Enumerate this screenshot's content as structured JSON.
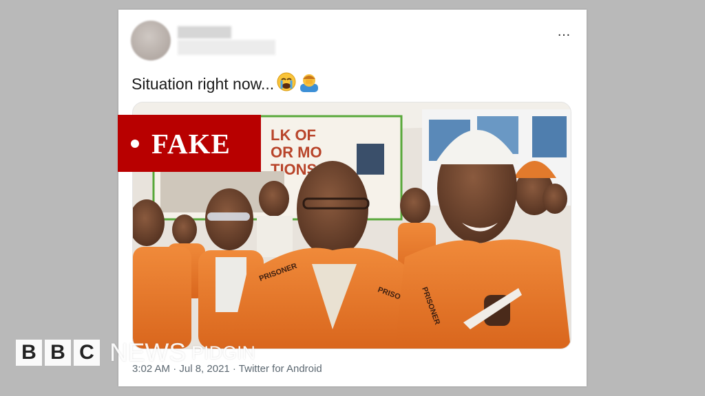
{
  "tweet": {
    "text": "Situation right now...",
    "emojis": [
      "crying-face-emoji",
      "person-facepalming-emoji"
    ],
    "timestamp": "3:02 AM · Jul 8, 2021 · Twitter for Android",
    "more_icon": "…"
  },
  "label": {
    "fake": "FAKE",
    "color": "#b80000"
  },
  "logo": {
    "letters": [
      "B",
      "B",
      "C"
    ],
    "news": "NEWS",
    "pidgin": "PIDGIN"
  },
  "media": {
    "banner_text": "LK OF\nOR MO\nTIONS"
  }
}
